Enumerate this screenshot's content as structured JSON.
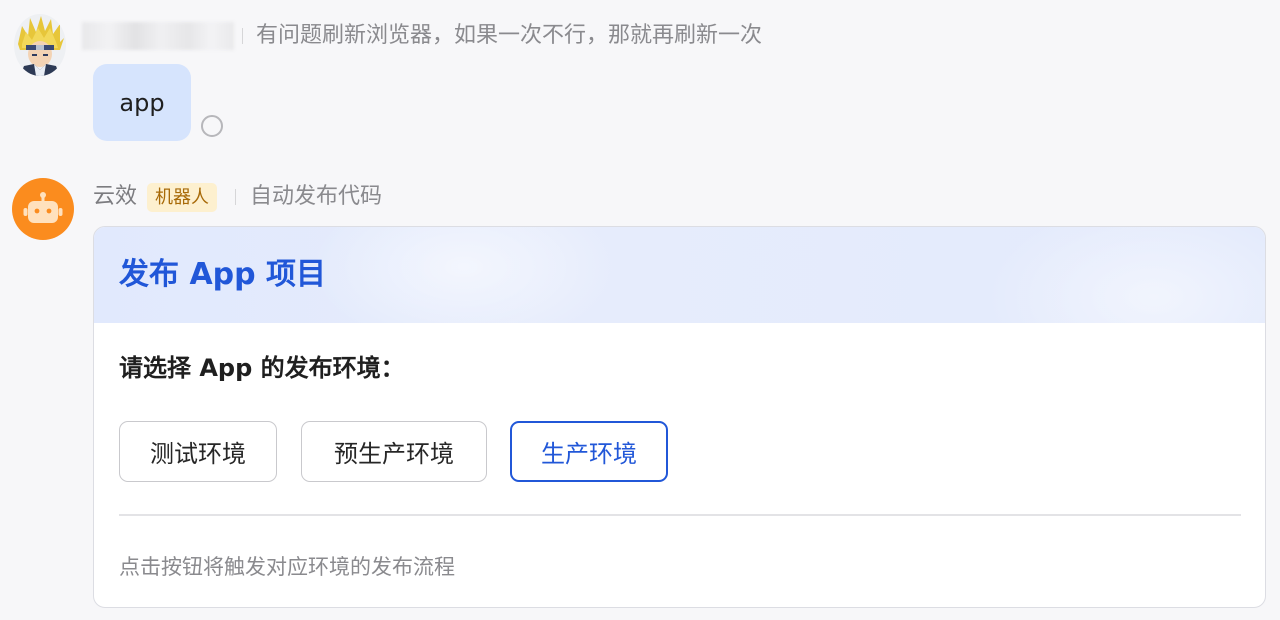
{
  "user_message": {
    "avatar": "anime-character-avatar",
    "sender_name": "",
    "signature": "有问题刷新浏览器，如果一次不行，那就再刷新一次",
    "text": "app",
    "status_icon": "pending-circle-icon"
  },
  "bot_message": {
    "avatar": "robot-icon",
    "sender_name": "云效",
    "badge": "机器人",
    "signature": "自动发布代码",
    "card": {
      "title": "发布 App 项目",
      "question": "请选择 App 的发布环境：",
      "buttons": [
        {
          "label": "测试环境",
          "style": "default"
        },
        {
          "label": "预生产环境",
          "style": "default"
        },
        {
          "label": "生产环境",
          "style": "primary"
        }
      ],
      "footer": "点击按钮将触发对应环境的发布流程"
    }
  },
  "colors": {
    "accent": "#2157d8",
    "bubble": "#d6e4fd",
    "bot_avatar": "#fb8c1e",
    "badge_bg": "#fdf0cf",
    "badge_text": "#a86a08"
  }
}
